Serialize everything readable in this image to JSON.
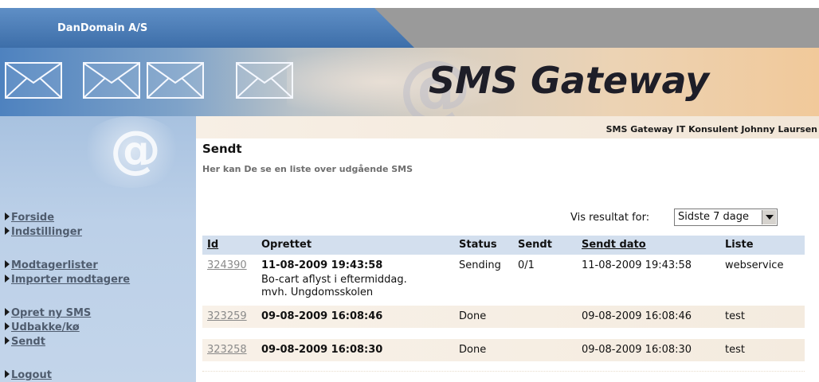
{
  "company_tab": "DanDomain A/S",
  "banner": {
    "title": "SMS Gateway"
  },
  "consultant": "SMS Gateway IT Konsulent Johnny Laursen",
  "nav": {
    "forside": "Forside",
    "indstillinger": "Indstillinger",
    "modtagerlister": "Modtagerlister",
    "importer": "Importer modtagere",
    "opret": "Opret ny SMS",
    "udbakke": "Udbakke/kø",
    "sendt": "Sendt",
    "logout": "Logout"
  },
  "page": {
    "title": "Sendt",
    "subtitle": "Her kan De se en liste over udgående SMS"
  },
  "filter": {
    "label": "Vis resultat for:",
    "selected": "Sidste 7 dage"
  },
  "table": {
    "headers": {
      "id": "Id",
      "created": "Oprettet",
      "status": "Status",
      "sent": "Sendt",
      "sent_date": "Sendt dato",
      "list": "Liste"
    },
    "rows": [
      {
        "id": "324390",
        "created": "11-08-2009 19:43:58",
        "message_line1": "Bo-cart aflyst i eftermiddag.",
        "message_line2": "mvh. Ungdomsskolen",
        "status": "Sending",
        "sent": "0/1",
        "sent_date": "11-08-2009 19:43:58",
        "list": "webservice"
      },
      {
        "id": "323259",
        "created": "09-08-2009 16:08:46",
        "status": "Done",
        "sent": "",
        "sent_date": "09-08-2009 16:08:46",
        "list": "test"
      },
      {
        "id": "323258",
        "created": "09-08-2009 16:08:30",
        "status": "Done",
        "sent": "",
        "sent_date": "09-08-2009 16:08:30",
        "list": "test"
      }
    ]
  },
  "colors": {
    "nav_bg": "#bcd0e8",
    "table_header": "#d3dfee",
    "tab_blue": "#3d6ea9"
  }
}
